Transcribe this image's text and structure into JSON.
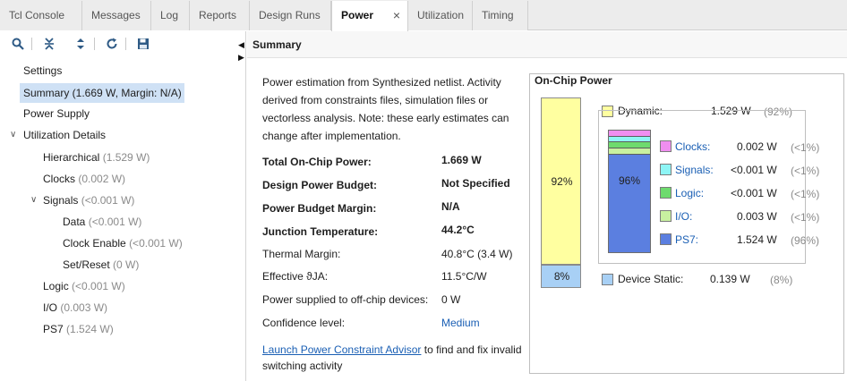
{
  "tabs": [
    {
      "label": "Tcl Console"
    },
    {
      "label": "Messages"
    },
    {
      "label": "Log"
    },
    {
      "label": "Reports"
    },
    {
      "label": "Design Runs"
    },
    {
      "label": "Power",
      "active": true,
      "close": "×"
    },
    {
      "label": "Utilization"
    },
    {
      "label": "Timing"
    }
  ],
  "toolbar": {
    "icons": [
      "search-icon",
      "collapse-all-icon",
      "expand-all-icon",
      "refresh-icon",
      "save-icon"
    ]
  },
  "tree": {
    "settings": "Settings",
    "summary": "Summary (1.669 W, Margin: N/A)",
    "power_supply": "Power Supply",
    "utilization_details": "Utilization Details",
    "hierarchical": {
      "label": "Hierarchical",
      "value": "(1.529 W)"
    },
    "clocks": {
      "label": "Clocks",
      "value": "(0.002 W)"
    },
    "signals": {
      "label": "Signals",
      "value": "(<0.001 W)"
    },
    "data": {
      "label": "Data",
      "value": "(<0.001 W)"
    },
    "clock_enable": {
      "label": "Clock Enable",
      "value": "(<0.001 W)"
    },
    "set_reset": {
      "label": "Set/Reset",
      "value": "(0 W)"
    },
    "logic": {
      "label": "Logic",
      "value": "(<0.001 W)"
    },
    "io": {
      "label": "I/O",
      "value": "(0.003 W)"
    },
    "ps7": {
      "label": "PS7",
      "value": "(1.524 W)"
    }
  },
  "summary": {
    "header": "Summary",
    "description": "Power estimation from Synthesized netlist. Activity derived from constraints files, simulation files or vectorless analysis. Note: these early estimates can change after implementation.",
    "rows": [
      {
        "label": "Total On-Chip Power:",
        "value": "1.669 W"
      },
      {
        "label": "Design Power Budget:",
        "value": "Not Specified"
      },
      {
        "label": "Power Budget Margin:",
        "value": "N/A"
      },
      {
        "label": "Junction Temperature:",
        "value": "44.2°C"
      },
      {
        "label": "Thermal Margin:",
        "value": "40.8°C (3.4 W)"
      },
      {
        "label": "Effective ϑJA:",
        "value": "11.5°C/W"
      },
      {
        "label": "Power supplied to off-chip devices:",
        "value": "0 W"
      },
      {
        "label": "Confidence level:",
        "value": "Medium"
      }
    ],
    "footer_link": "Launch Power Constraint Advisor",
    "footer_text": " to find and fix invalid switching activity"
  },
  "on_chip": {
    "title": "On-Chip Power",
    "dynamic": {
      "label": "Dynamic:",
      "value": "1.529 W",
      "pct": "(92%)",
      "bar_label": "92%",
      "fraction": 0.92,
      "color": "#ffffa0"
    },
    "device_static": {
      "label": "Device Static:",
      "value": "0.139 W",
      "pct": "(8%)",
      "bar_label": "8%",
      "fraction": 0.08,
      "color": "#a8d0f5"
    },
    "inner_bar_label": "96%",
    "items": [
      {
        "label": "Clocks:",
        "value": "0.002 W",
        "pct": "(<1%)",
        "color": "#f08ef0"
      },
      {
        "label": "Signals:",
        "value": "<0.001 W",
        "pct": "(<1%)",
        "color": "#8ef5f5"
      },
      {
        "label": "Logic:",
        "value": "<0.001 W",
        "pct": "(<1%)",
        "color": "#6edb6e"
      },
      {
        "label": "I/O:",
        "value": "0.003 W",
        "pct": "(<1%)",
        "color": "#c8f0a0"
      },
      {
        "label": "PS7:",
        "value": "1.524 W",
        "pct": "(96%)",
        "color": "#5b7fe0"
      }
    ]
  }
}
